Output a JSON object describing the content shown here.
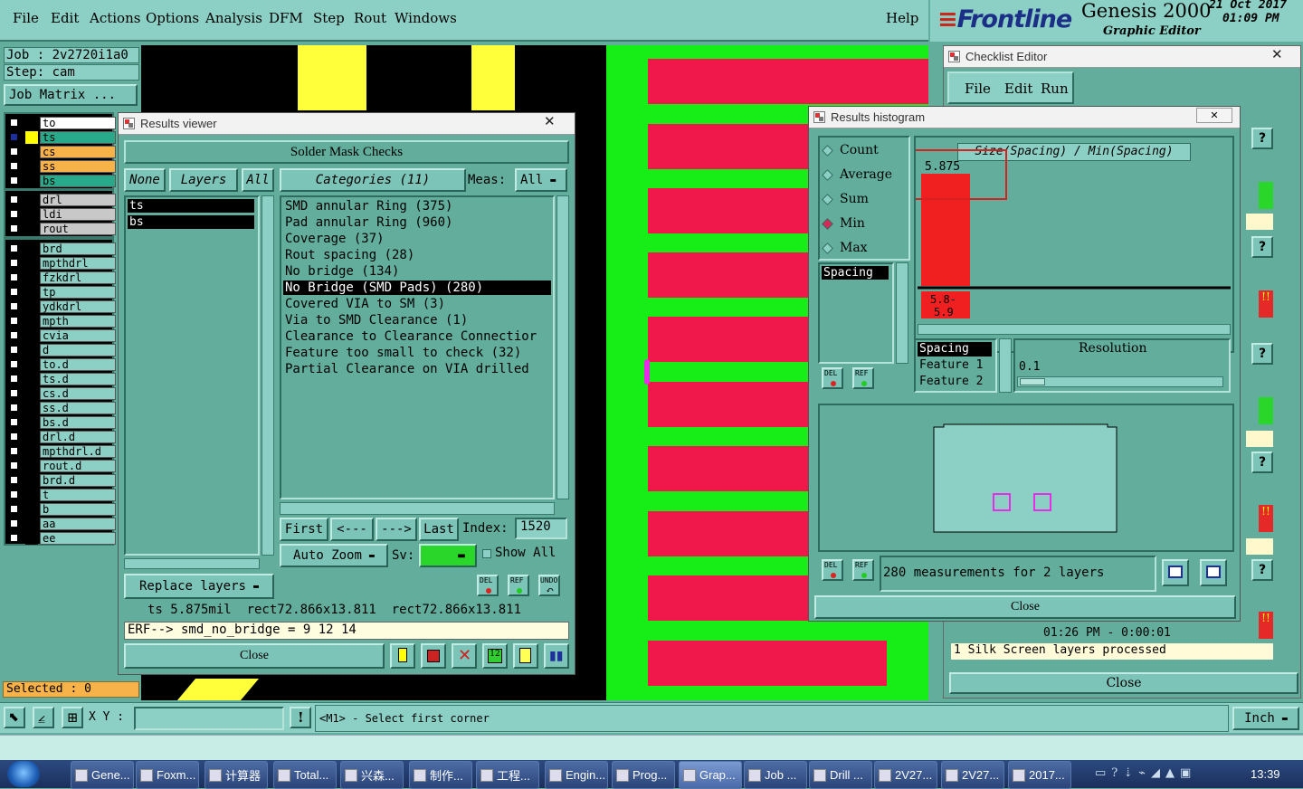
{
  "menu": {
    "items": [
      "File",
      "Edit",
      "Actions",
      "Options",
      "Analysis",
      "DFM",
      "Step",
      "Rout",
      "Windows"
    ],
    "help": "Help"
  },
  "brand": {
    "logo": "Frontline",
    "product": "Genesis 2000",
    "sub": "Graphic Editor",
    "date": "21 Oct 2017",
    "time": "01:09 PM"
  },
  "job": {
    "job": "Job : 2v2720i1a0",
    "step": "Step: cam",
    "matrix": "Job Matrix ..."
  },
  "layers": {
    "group1": [
      {
        "name": "to",
        "color": "#ffffff"
      },
      {
        "name": "ts",
        "color": "#29a88a",
        "active": true
      },
      {
        "name": "cs",
        "color": "#f7b24a"
      },
      {
        "name": "ss",
        "color": "#f7b24a"
      },
      {
        "name": "bs",
        "color": "#29a88a"
      }
    ],
    "group2": [
      {
        "name": "drl",
        "color": "#c8c8c8"
      },
      {
        "name": "ldi",
        "color": "#c8c8c8"
      },
      {
        "name": "rout",
        "color": "#c8c8c8"
      }
    ],
    "group3": [
      "brd",
      "mpthdrl",
      "fzkdrl",
      "tp",
      "ydkdrl",
      "mpth",
      "cvia",
      "d",
      "to.d",
      "ts.d",
      "cs.d",
      "ss.d",
      "bs.d",
      "drl.d",
      "mpthdrl.d",
      "rout.d",
      "brd.d",
      "t",
      "b",
      "aa",
      "ee"
    ]
  },
  "selected": "Selected : 0",
  "results_viewer": {
    "title": "Results viewer",
    "header": "Solder Mask Checks",
    "none": "None",
    "layers": "Layers",
    "all": "All",
    "categories": "Categories (11)",
    "meas_label": "Meas:",
    "meas_value": "All",
    "layer_list": [
      "ts",
      "bs"
    ],
    "items": [
      "SMD annular Ring (375)",
      "Pad annular Ring (960)",
      "Coverage (37)",
      "Rout spacing (28)",
      "No bridge (134)",
      "No Bridge (SMD Pads) (280)",
      "Covered VIA to SM (3)",
      "Via to SMD Clearance (1)",
      "Clearance to Clearance Connectior",
      "Feature too small to check (32)",
      "Partial Clearance on VIA drilled"
    ],
    "first": "First",
    "prev": "<---",
    "next": "--->",
    "last": "Last",
    "index_label": "Index:",
    "index_value": "1520",
    "auto_zoom": "Auto Zoom",
    "sv": "Sv:",
    "show_all": "Show All",
    "replace": "Replace layers",
    "del": "DEL",
    "ref": "REF",
    "undo": "UNDO",
    "status": "ts 5.875mil  rect72.866x13.811  rect72.866x13.811",
    "erf": "ERF--> smd_no_bridge = 9 12 14",
    "close": "Close"
  },
  "histogram": {
    "title": "Results histogram",
    "modes": [
      "Count",
      "Average",
      "Sum",
      "Min",
      "Max"
    ],
    "chart_title": "Size(Spacing) / Min(Spacing)",
    "spacing": "Spacing",
    "params": [
      "Spacing",
      "Feature 1",
      "Feature 2"
    ],
    "resolution_label": "Resolution",
    "resolution": "0.1",
    "del": "DEL",
    "ref": "REF",
    "summary": "280 measurements for 2 layers",
    "close": "Close"
  },
  "chart_data": {
    "type": "bar",
    "categories": [
      "5.8-5.9"
    ],
    "values": [
      5.875
    ],
    "data_labels": [
      "5.875"
    ],
    "title": "Size(Spacing) / Min(Spacing)"
  },
  "checklist": {
    "title": "Checklist Editor",
    "menu": [
      "File",
      "Edit",
      "Run"
    ],
    "time_row": "01:26 PM - 0:00:01",
    "status": "1 Silk Screen layers processed",
    "close": "Close"
  },
  "bottom": {
    "xy": "X Y :",
    "prompt": "<M1> - Select first corner",
    "units": "Inch"
  },
  "taskbar": {
    "items": [
      "Gene...",
      "Foxm...",
      "计算器",
      "Total...",
      "兴森...",
      "制作...",
      "工程...",
      "Engin...",
      "Prog...",
      "Grap...",
      "Job ...",
      "Drill ...",
      "2V27...",
      "2V27...",
      "2017..."
    ],
    "clock": "13:39"
  }
}
